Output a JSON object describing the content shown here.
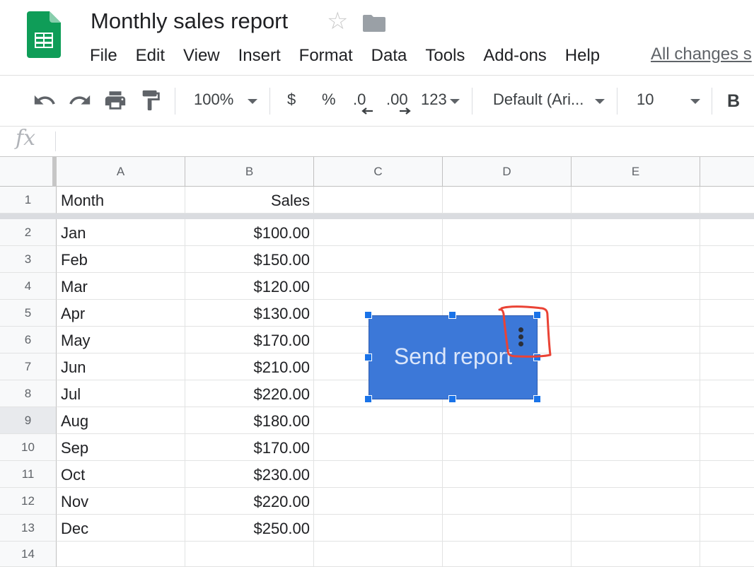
{
  "title_bar": {
    "doc_title": "Monthly sales report",
    "star_icon": "star-outline-icon",
    "folder_icon": "folder-icon",
    "saved_status": "All changes s"
  },
  "menu": [
    "File",
    "Edit",
    "View",
    "Insert",
    "Format",
    "Data",
    "Tools",
    "Add-ons",
    "Help"
  ],
  "toolbar": {
    "zoom": "100%",
    "currency": "$",
    "percent": "%",
    "decrease_decimal": ".0",
    "increase_decimal": ".00",
    "more_formats": "123",
    "font": "Default (Ari...",
    "font_size": "10",
    "bold": "B"
  },
  "formula_bar": {
    "label": "fx"
  },
  "grid": {
    "columns": [
      "A",
      "B",
      "C",
      "D",
      "E"
    ],
    "rows": [
      {
        "num": "1",
        "a": "Month",
        "b": "Sales"
      },
      {
        "num": "2",
        "a": "Jan",
        "b": "$100.00"
      },
      {
        "num": "3",
        "a": "Feb",
        "b": "$150.00"
      },
      {
        "num": "4",
        "a": "Mar",
        "b": "$120.00"
      },
      {
        "num": "5",
        "a": "Apr",
        "b": "$130.00"
      },
      {
        "num": "6",
        "a": "May",
        "b": "$170.00"
      },
      {
        "num": "7",
        "a": "Jun",
        "b": "$210.00"
      },
      {
        "num": "8",
        "a": "Jul",
        "b": "$220.00"
      },
      {
        "num": "9",
        "a": "Aug",
        "b": "$180.00"
      },
      {
        "num": "10",
        "a": "Sep",
        "b": "$170.00"
      },
      {
        "num": "11",
        "a": "Oct",
        "b": "$230.00"
      },
      {
        "num": "12",
        "a": "Nov",
        "b": "$220.00"
      },
      {
        "num": "13",
        "a": "Dec",
        "b": "$250.00"
      },
      {
        "num": "14",
        "a": "",
        "b": ""
      }
    ]
  },
  "drawing": {
    "label": "Send report",
    "color": "#3c78d8",
    "menu_icon": "more-vertical-icon"
  },
  "colors": {
    "sheets_green": "#0f9d58",
    "selection_blue": "#1a73e8",
    "annotation_red": "#ea4335"
  }
}
